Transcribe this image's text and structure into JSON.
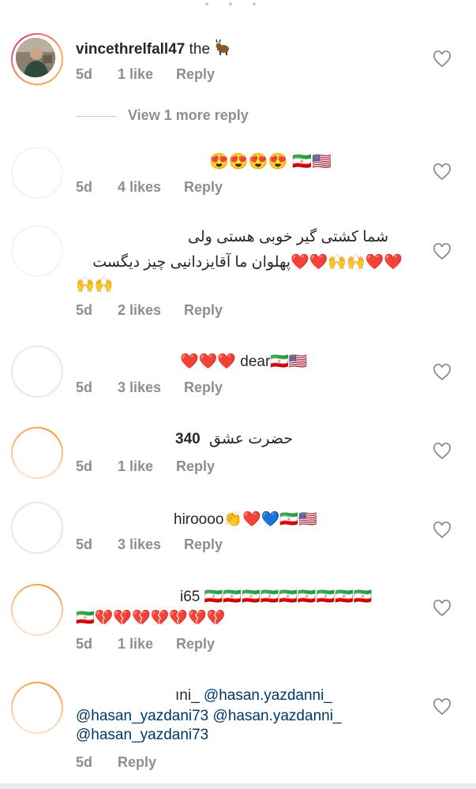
{
  "comments": [
    {
      "username": "vincethrelfall47",
      "text": "the",
      "emoji_icon": "goat-emoji",
      "time": "5d",
      "likes": "1 like",
      "reply": "Reply",
      "view_more": "View 1 more reply"
    },
    {
      "emoji_text": "😍😍😍😍 🇮🇷🇺🇸",
      "time": "5d",
      "likes": "4 likes",
      "reply": "Reply"
    },
    {
      "line1": "شما کشتی گیر خوبی هستی ولی",
      "line2": "پهلوان ما آقایزدانیی چیز دیگست",
      "emoji_line": "❤️❤️🙌🙌❤️❤️",
      "emoji_line3": "🙌🙌",
      "time": "5d",
      "likes": "2 likes",
      "reply": "Reply"
    },
    {
      "text": "❤️❤️❤️ dear🇮🇷🇺🇸",
      "time": "5d",
      "likes": "3 likes",
      "reply": "Reply"
    },
    {
      "text_rtl": "حضرت عشق",
      "text_num": "340",
      "time": "5d",
      "likes": "1 like",
      "reply": "Reply"
    },
    {
      "text": "hiroooo👏❤️💙🇮🇷🇺🇸",
      "time": "5d",
      "likes": "3 likes",
      "reply": "Reply"
    },
    {
      "text_prefix": "i65",
      "flags": "🇮🇷🇮🇷🇮🇷🇮🇷🇮🇷🇮🇷🇮🇷🇮🇷🇮🇷",
      "line2": "🇮🇷💔💔💔💔💔💔💔",
      "time": "5d",
      "likes": "1 like",
      "reply": "Reply"
    },
    {
      "prefix": "ıni_",
      "mention1": "@hasan.yazdanni_",
      "mention2": "@hasan_yazdani73",
      "mention3": "@hasan.yazdanni_",
      "mention4": "@hasan_yazdani73",
      "time": "5d",
      "reply": "Reply"
    }
  ],
  "icons": {
    "like": "heart-outline-icon"
  },
  "colors": {
    "text": "#262626",
    "meta": "#8e8e8e",
    "mention": "#00376b"
  }
}
